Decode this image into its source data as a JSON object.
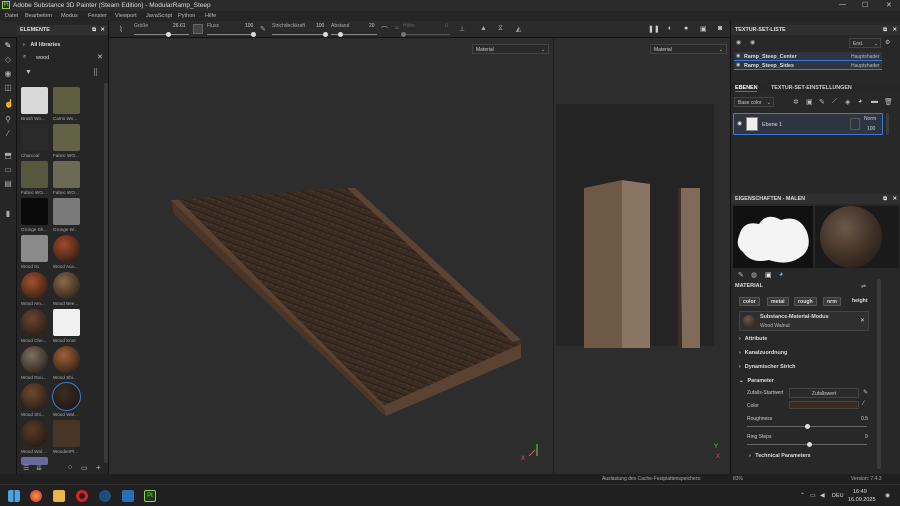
{
  "window": {
    "title": "Adobe Substance 3D Painter (Steam Edition) - ModularRamp_Steep",
    "app_icon": "Pt"
  },
  "menu": [
    "Datei",
    "Bearbeiten",
    "Modus",
    "Fenster",
    "Viewport",
    "JavaScript",
    "Python",
    "Hilfe"
  ],
  "toolbar": {
    "size_label": "Größe",
    "size_value": "26.61",
    "size_fraction": 0.62,
    "flow_label": "Fluss",
    "flow_value": "100",
    "flow_fraction": 1.0,
    "stroke_label": "Strichdeckkraft",
    "stroke_value": "100",
    "stroke_fraction": 1.0,
    "spacing_label": "Abstand",
    "spacing_value": "20",
    "spacing_fraction": 0.2,
    "height_label": "Höhe",
    "height_value": "0",
    "height_fraction": 0.0
  },
  "assets": {
    "header": "ELEMENTE",
    "library": "All libraries",
    "search_value": "wood",
    "items": [
      {
        "label": "Brush Wo...",
        "color": "#d8d8d8"
      },
      {
        "label": "Camo Wo...",
        "color": "#5c5e3f"
      },
      {
        "label": "Charcoal",
        "color": "#2a2a2a"
      },
      {
        "label": "Fabric WO...",
        "color": "#616246"
      },
      {
        "label": "Fabric WO...",
        "color": "#55583c"
      },
      {
        "label": "Fabric WO...",
        "color": "#6b6b55"
      },
      {
        "label": "Grunge Sh...",
        "color": "#0a0a0a"
      },
      {
        "label": "Grunge W...",
        "color": "#7a7a7a"
      },
      {
        "label": "Wood 01",
        "color": "#8a8a8a"
      },
      {
        "label": "Wood Aca...",
        "color": "#a44a28"
      },
      {
        "label": "Wood Am...",
        "color": "#a5502a"
      },
      {
        "label": "Wood Bee...",
        "color": "#8c6a48"
      },
      {
        "label": "Wood Che...",
        "color": "#6a4530"
      },
      {
        "label": "Wood Knot",
        "color": "#f0f0f0"
      },
      {
        "label": "Wood Rou...",
        "color": "#7d7060"
      },
      {
        "label": "Wood Shi...",
        "color": "#a06038"
      },
      {
        "label": "Wood Shi...",
        "color": "#6d4a30"
      },
      {
        "label": "Wood Wal...",
        "color": "#3a2c22"
      },
      {
        "label": "Wood Wal...",
        "color": "#5a3a26"
      },
      {
        "label": "WoodenPl...",
        "color": "#4a3426"
      },
      {
        "label": "",
        "color": "#6a6a9a"
      }
    ]
  },
  "viewport": {
    "left_mode": "Material",
    "right_mode": "Material",
    "axis_x": "X",
    "axis_y": "Y"
  },
  "texture_set_list": {
    "header": "TEXTUR-SET-LISTE",
    "dropdown": "Erst.",
    "sets": [
      {
        "name": "Ramp_Steep_Center",
        "shader": "Hauptshader"
      },
      {
        "name": "Ramp_Steep_Sides",
        "shader": "Hauptshader"
      }
    ]
  },
  "layers": {
    "tab_layers": "EBENEN",
    "tab_settings": "TEXTUR-SET-EINSTELLUNGEN",
    "channel": "Base color",
    "layer_name": "Ebene 1",
    "blend": "Norm",
    "opacity": "100"
  },
  "properties": {
    "header": "EIGENSCHAFTEN - MALEN",
    "material_title": "MATERIAL",
    "channels": [
      "color",
      "metal",
      "rough",
      "nrm",
      "height"
    ],
    "mode_title": "Substance-Material-Modus",
    "mode_value": "Wood Walnut",
    "sections": [
      "Attribute",
      "Kanalzuordnung",
      "Dynamischer Strich",
      "Parameter"
    ],
    "random_label": "Zufalls-Startwert",
    "random_value": "Zufallswert",
    "color_label": "Color",
    "color_swatch": "#3a2a20",
    "roughness_label": "Roughness",
    "roughness_value": "0.5",
    "roughness_fraction": 0.5,
    "ring_label": "Ring Steps",
    "ring_value": "9",
    "ring_fraction": 0.52,
    "technical": "Technical Parameters"
  },
  "status": {
    "text": "Auslastung des Cache-Festplattenspeichers:",
    "cache": "83%",
    "version": "Version: 7.4.3"
  },
  "taskbar": {
    "lang": "DEU",
    "time": "16:49",
    "date": "16.09.2025"
  }
}
